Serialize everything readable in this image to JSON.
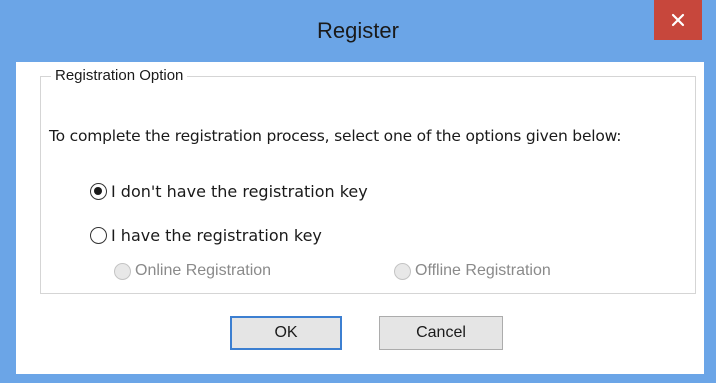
{
  "window": {
    "title": "Register",
    "close_icon": "close-icon"
  },
  "groupbox": {
    "legend": "Registration Option"
  },
  "instruction": "To complete the registration process, select one of the options given below:",
  "options": {
    "no_key": {
      "label": "I don't have the registration key",
      "checked": true
    },
    "have_key": {
      "label": "I have the registration key",
      "checked": false
    },
    "online": {
      "label": "Online Registration",
      "enabled": false
    },
    "offline": {
      "label": "Offline Registration",
      "enabled": false
    }
  },
  "buttons": {
    "ok": "OK",
    "cancel": "Cancel"
  },
  "colors": {
    "titlebar": "#6ba5e7",
    "close": "#c7473c",
    "default_button_border": "#3c7fd1"
  }
}
